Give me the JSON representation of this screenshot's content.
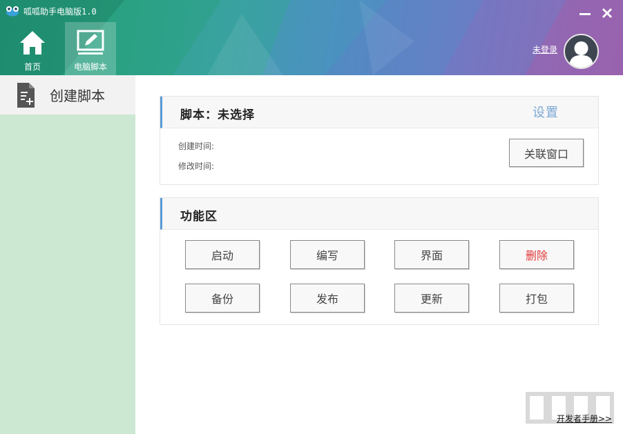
{
  "app": {
    "title": "呱呱助手电脑版1.0"
  },
  "nav": {
    "tabs": [
      {
        "label": "首页",
        "icon": "home-icon",
        "active": false
      },
      {
        "label": "电脑脚本",
        "icon": "edit-screen-icon",
        "active": true
      }
    ]
  },
  "user": {
    "login_label": "未登录",
    "avatar_icon": "user-avatar-icon"
  },
  "sidebar": {
    "items": [
      {
        "label": "创建脚本",
        "icon": "new-document-icon"
      }
    ]
  },
  "script_panel": {
    "title": "脚本：未选择",
    "settings_label": "设置",
    "created_label": "创建时间:",
    "modified_label": "修改时间:",
    "associate_button": "关联窗口"
  },
  "function_panel": {
    "title": "功能区",
    "buttons": [
      {
        "label": "启动"
      },
      {
        "label": "编写"
      },
      {
        "label": "界面"
      },
      {
        "label": "删除"
      },
      {
        "label": "备份"
      },
      {
        "label": "发布"
      },
      {
        "label": "更新"
      },
      {
        "label": "打包"
      }
    ]
  },
  "footer": {
    "manual_link": "开发者手册>>"
  },
  "colors": {
    "sidebar_bg": "#cde8d2",
    "accent_blue": "#5b9bd5",
    "danger_red": "#e03a3a",
    "settings_blue": "#7aa7d6"
  }
}
